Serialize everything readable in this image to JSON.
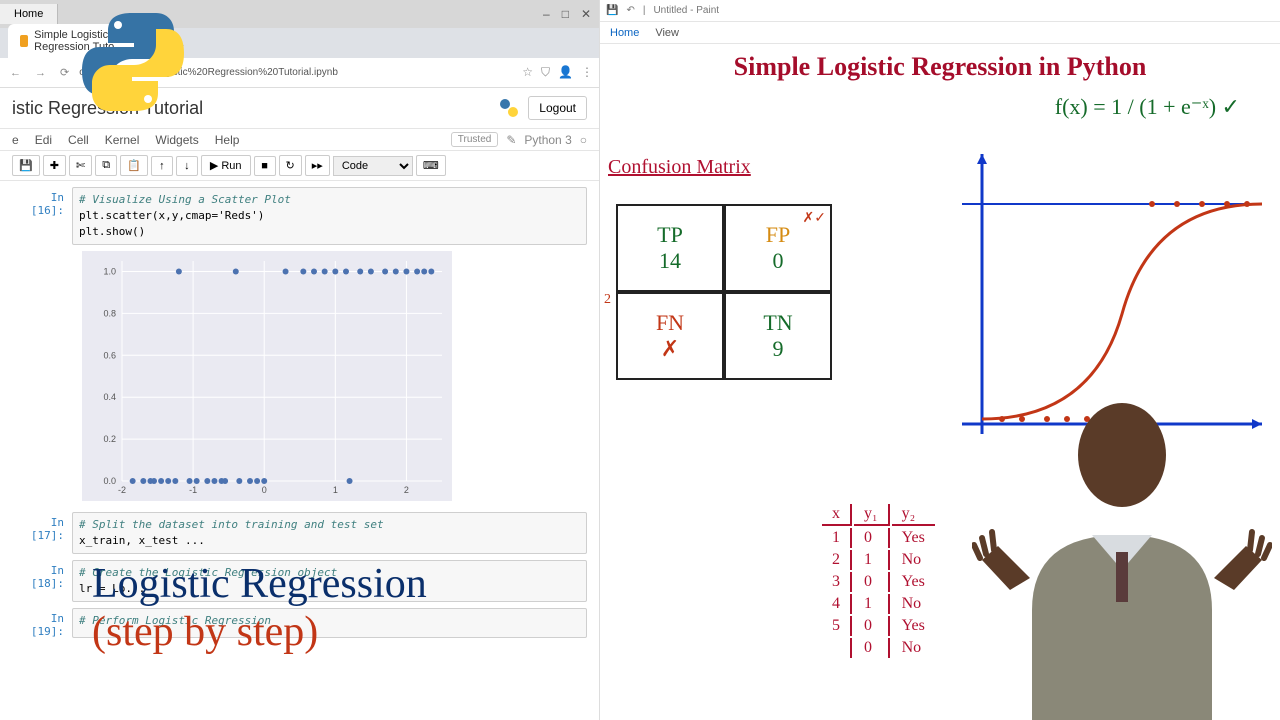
{
  "chrome": {
    "home_label": "Home",
    "tab_title": "Simple Logistic Regression Tuto",
    "url_fragment": "ooks/Simple%20Logistic%20Regression%20Tutorial.ipynb",
    "win_controls": [
      "–",
      "□",
      "✕"
    ]
  },
  "jupyter": {
    "title_visible": "istic Regression Tutorial",
    "logout": "Logout",
    "menus": [
      "e",
      "Edi",
      "Cell",
      "Kernel",
      "Widgets",
      "Help"
    ],
    "trusted": "Trusted",
    "kernel": "Python 3",
    "toolbar": {
      "run": "▶ Run",
      "celltype": "Code"
    },
    "cells": [
      {
        "prompt": "In [16]:",
        "lines": [
          {
            "t": "# Visualize Using a Scatter Plot",
            "cls": "comment"
          },
          {
            "t": "plt.scatter(x,y,cmap='Reds')",
            "cls": ""
          },
          {
            "t": "plt.show()",
            "cls": ""
          }
        ]
      },
      {
        "prompt": "In [17]:",
        "lines": [
          {
            "t": "# Split the dataset into training and test set",
            "cls": "comment"
          },
          {
            "t": "x_train, x_test ...",
            "cls": ""
          }
        ]
      },
      {
        "prompt": "In [18]:",
        "lines": [
          {
            "t": "# Create the Logistic Regression object",
            "cls": "comment"
          },
          {
            "t": "lr = Lo...",
            "cls": ""
          }
        ]
      },
      {
        "prompt": "In [19]:",
        "lines": [
          {
            "t": "# Perform Logistic Regression",
            "cls": "comment"
          }
        ]
      }
    ]
  },
  "chart_data": {
    "type": "scatter",
    "title": "",
    "xlabel": "",
    "ylabel": "",
    "xlim": [
      -2,
      2.5
    ],
    "ylim": [
      0,
      1.05
    ],
    "xticks": [
      -2,
      -1,
      0,
      1,
      2
    ],
    "yticks": [
      0.0,
      0.2,
      0.4,
      0.6,
      0.8,
      1.0
    ],
    "points": [
      {
        "x": -1.85,
        "y": 0.0
      },
      {
        "x": -1.7,
        "y": 0.0
      },
      {
        "x": -1.55,
        "y": 0.0
      },
      {
        "x": -1.45,
        "y": 0.0
      },
      {
        "x": -1.35,
        "y": 0.0
      },
      {
        "x": -1.2,
        "y": 1.0
      },
      {
        "x": -1.05,
        "y": 0.0
      },
      {
        "x": -0.95,
        "y": 0.0
      },
      {
        "x": -0.8,
        "y": 0.0
      },
      {
        "x": -0.7,
        "y": 0.0
      },
      {
        "x": -0.55,
        "y": 0.0
      },
      {
        "x": -0.4,
        "y": 1.0
      },
      {
        "x": -0.35,
        "y": 0.0
      },
      {
        "x": -0.2,
        "y": 0.0
      },
      {
        "x": 0.0,
        "y": 0.0
      },
      {
        "x": 0.3,
        "y": 1.0
      },
      {
        "x": 0.55,
        "y": 1.0
      },
      {
        "x": 0.7,
        "y": 1.0
      },
      {
        "x": 0.85,
        "y": 1.0
      },
      {
        "x": 1.0,
        "y": 1.0
      },
      {
        "x": 1.15,
        "y": 1.0
      },
      {
        "x": 1.2,
        "y": 0.0
      },
      {
        "x": 1.35,
        "y": 1.0
      },
      {
        "x": 1.5,
        "y": 1.0
      },
      {
        "x": 1.7,
        "y": 1.0
      },
      {
        "x": 1.85,
        "y": 1.0
      },
      {
        "x": 2.0,
        "y": 1.0
      },
      {
        "x": 2.15,
        "y": 1.0
      },
      {
        "x": 2.25,
        "y": 1.0
      },
      {
        "x": 2.35,
        "y": 1.0
      },
      {
        "x": -1.6,
        "y": 0.0
      },
      {
        "x": -1.25,
        "y": 0.0
      },
      {
        "x": -0.6,
        "y": 0.0
      },
      {
        "x": -0.1,
        "y": 0.0
      }
    ]
  },
  "paint": {
    "app": "Untitled - Paint",
    "tabs": [
      "Home",
      "View"
    ],
    "wb_title": "Simple Logistic Regression in Python",
    "formula": "f(x) = 1 / (1 + e⁻ˣ)  ✓",
    "confusion_title": "Confusion Matrix",
    "cm": {
      "tp": {
        "label": "TP",
        "n": "14",
        "color": "#156b2a"
      },
      "fp": {
        "label": "FP",
        "n": "0",
        "color": "#d58b12",
        "mark": "✗✓"
      },
      "fn": {
        "label": "FN",
        "n": "✗",
        "color": "#c23616",
        "mark": "2"
      },
      "tn": {
        "label": "TN",
        "n": "9",
        "color": "#156b2a"
      }
    },
    "table": {
      "headers": [
        "x",
        "y₁",
        "y₂"
      ],
      "rows": [
        [
          "1",
          "0",
          "Yes"
        ],
        [
          "2",
          "1",
          "No"
        ],
        [
          "3",
          "0",
          "Yes"
        ],
        [
          "4",
          "1",
          "No"
        ],
        [
          "5",
          "0",
          "Yes"
        ],
        [
          "",
          "0",
          "No"
        ]
      ]
    }
  },
  "overlay": {
    "line1": "Logistic Regression",
    "line2": "(step by step)"
  }
}
